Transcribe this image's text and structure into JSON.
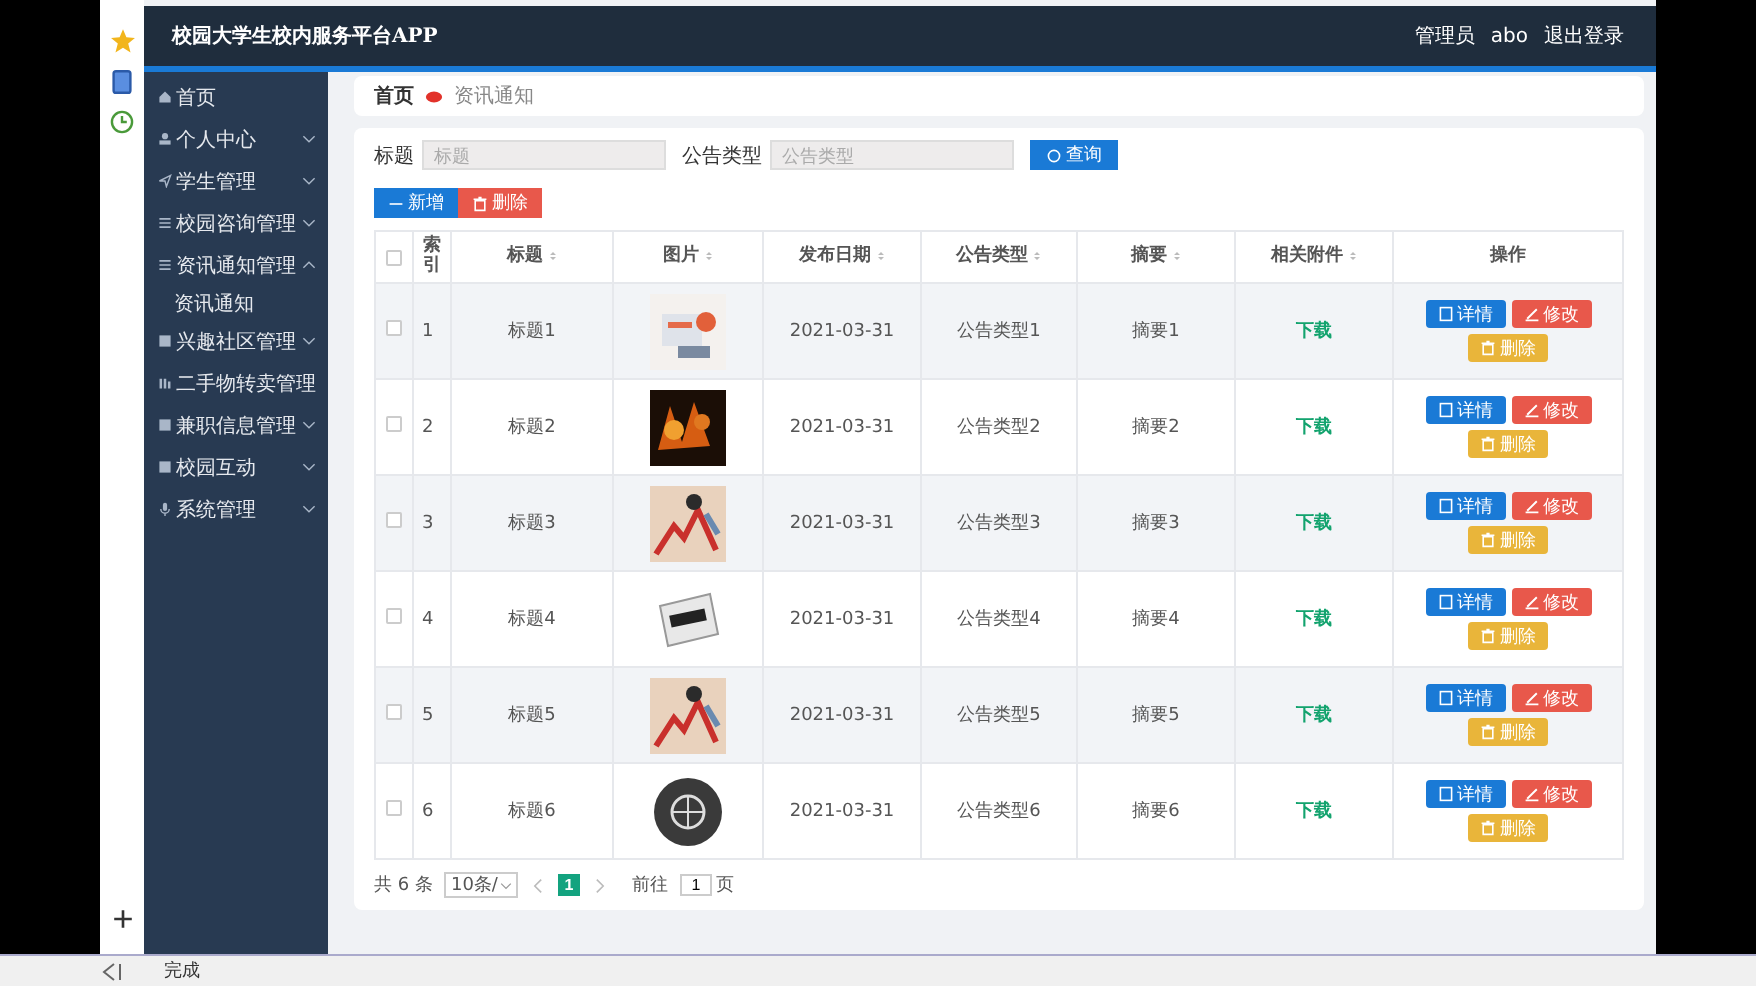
{
  "app": {
    "title": "校园大学生校内服务平台APP",
    "user_role": "管理员",
    "user_name": "abo",
    "logout": "退出登录"
  },
  "sidebar": {
    "items": [
      {
        "label": "首页",
        "has_children": false
      },
      {
        "label": "个人中心",
        "expanded": false,
        "has_children": true
      },
      {
        "label": "学生管理",
        "expanded": false,
        "has_children": true
      },
      {
        "label": "校园咨询管理",
        "expanded": false,
        "has_children": true
      },
      {
        "label": "资讯通知管理",
        "expanded": true,
        "has_children": true,
        "children": [
          {
            "label": "资讯通知"
          }
        ]
      },
      {
        "label": "兴趣社区管理",
        "expanded": false,
        "has_children": true
      },
      {
        "label": "二手物转卖管理",
        "has_children": false
      },
      {
        "label": "兼职信息管理",
        "expanded": false,
        "has_children": true
      },
      {
        "label": "校园互动",
        "expanded": false,
        "has_children": true
      },
      {
        "label": "系统管理",
        "expanded": false,
        "has_children": true
      }
    ]
  },
  "breadcrumb": [
    "首页",
    "资讯通知"
  ],
  "search": {
    "fields": [
      {
        "label": "标题",
        "placeholder": "标题"
      },
      {
        "label": "公告类型",
        "placeholder": "公告类型"
      }
    ],
    "button": "查询"
  },
  "actions": [
    {
      "label": "新增",
      "kind": "add"
    },
    {
      "label": "删除",
      "kind": "delete"
    }
  ],
  "table": {
    "select_all_checked": false,
    "columns": [
      {
        "sortable": false
      },
      {
        "label": "索引",
        "sortable": false
      },
      {
        "label": "标题",
        "sortable": true
      },
      {
        "label": "图片",
        "sortable": true
      },
      {
        "label": "发布日期",
        "sortable": true
      },
      {
        "label": "公告类型",
        "sortable": true
      },
      {
        "label": "摘要",
        "sortable": true
      },
      {
        "label": "相关附件",
        "sortable": true
      },
      {
        "label": "操作",
        "sortable": false
      }
    ],
    "rows": [
      {
        "checked": false,
        "index": "1",
        "title": "标题1",
        "date": "2021-03-31",
        "type": "公告类型1",
        "summary": "摘要1",
        "attachment": "下载",
        "buttons": [
          {
            "label": "详情",
            "kind": "detail"
          },
          {
            "label": "修改",
            "kind": "edit"
          },
          {
            "label": "删除",
            "kind": "delete"
          }
        ]
      },
      {
        "checked": false,
        "index": "2",
        "title": "标题2",
        "date": "2021-03-31",
        "type": "公告类型2",
        "summary": "摘要2",
        "attachment": "下载",
        "buttons": [
          {
            "label": "详情",
            "kind": "detail"
          },
          {
            "label": "修改",
            "kind": "edit"
          },
          {
            "label": "删除",
            "kind": "delete"
          }
        ]
      },
      {
        "checked": false,
        "index": "3",
        "title": "标题3",
        "date": "2021-03-31",
        "type": "公告类型3",
        "summary": "摘要3",
        "attachment": "下载",
        "buttons": [
          {
            "label": "详情",
            "kind": "detail"
          },
          {
            "label": "修改",
            "kind": "edit"
          },
          {
            "label": "删除",
            "kind": "delete"
          }
        ]
      },
      {
        "checked": false,
        "index": "4",
        "title": "标题4",
        "date": "2021-03-31",
        "type": "公告类型4",
        "summary": "摘要4",
        "attachment": "下载",
        "buttons": [
          {
            "label": "详情",
            "kind": "detail"
          },
          {
            "label": "修改",
            "kind": "edit"
          },
          {
            "label": "删除",
            "kind": "delete"
          }
        ]
      },
      {
        "checked": false,
        "index": "5",
        "title": "标题5",
        "date": "2021-03-31",
        "type": "公告类型5",
        "summary": "摘要5",
        "attachment": "下载",
        "buttons": [
          {
            "label": "详情",
            "kind": "detail"
          },
          {
            "label": "修改",
            "kind": "edit"
          },
          {
            "label": "删除",
            "kind": "delete"
          }
        ]
      },
      {
        "checked": false,
        "index": "6",
        "title": "标题6",
        "date": "2021-03-31",
        "type": "公告类型6",
        "summary": "摘要6",
        "attachment": "下载",
        "buttons": [
          {
            "label": "详情",
            "kind": "detail"
          },
          {
            "label": "修改",
            "kind": "edit"
          },
          {
            "label": "删除",
            "kind": "delete"
          }
        ]
      }
    ]
  },
  "pagination": {
    "total_prefix": "共",
    "total": "6",
    "total_suffix": "条",
    "page_size": "10条/",
    "pages": [
      {
        "label": "1",
        "selected": true
      }
    ],
    "goto_label": "前往",
    "goto_value": "1",
    "goto_suffix": "页"
  },
  "status_bar": {
    "text": "完成"
  }
}
